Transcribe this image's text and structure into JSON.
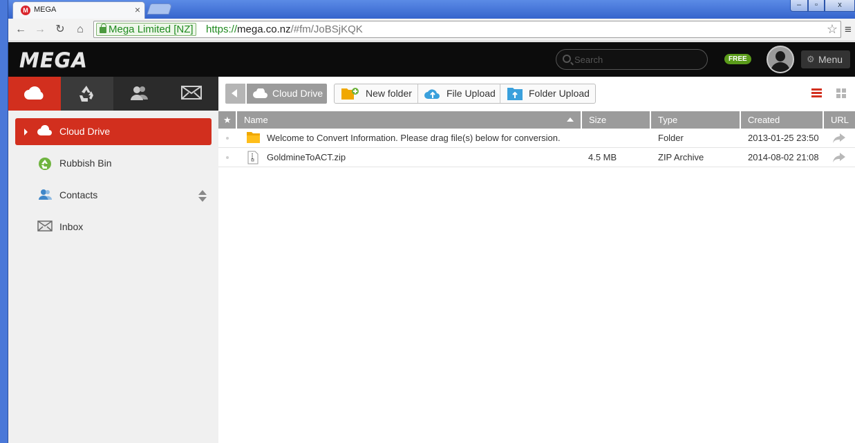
{
  "browser": {
    "tab_title": "MEGA",
    "tab_close": "×",
    "window_min": "–",
    "window_max": "▫",
    "window_close": "x",
    "nav_back": "←",
    "nav_forward": "→",
    "nav_reload": "↻",
    "nav_home": "⌂",
    "ev_cert": "Mega Limited [NZ]",
    "url_scheme": "https://",
    "url_host": "mega.co.nz",
    "url_path": "/#fm/JoBSjKQK",
    "star": "☆",
    "menu": "≡"
  },
  "header": {
    "logo": "MEGA",
    "search_placeholder": "Search",
    "badge": "FREE",
    "menu_label": "Menu",
    "gear": "⚙"
  },
  "sidebar": {
    "items": [
      {
        "label": "Cloud Drive"
      },
      {
        "label": "Rubbish Bin"
      },
      {
        "label": "Contacts"
      },
      {
        "label": "Inbox"
      }
    ]
  },
  "toolbar": {
    "breadcrumb": "Cloud Drive",
    "new_folder": "New folder",
    "file_upload": "File Upload",
    "folder_upload": "Folder Upload"
  },
  "table": {
    "star_header": "★",
    "columns": {
      "name": "Name",
      "size": "Size",
      "type": "Type",
      "created": "Created",
      "url": "URL"
    },
    "rows": [
      {
        "name": "Welcome to Convert Information.  Please drag file(s) below for conversion.",
        "size": "",
        "type": "Folder",
        "created": "2013-01-25 23:50",
        "icon": "folder-icon"
      },
      {
        "name": "GoldmineToACT.zip",
        "size": "4.5 MB",
        "type": "ZIP Archive",
        "created": "2014-08-02 21:08",
        "icon": "zip-file-icon"
      }
    ]
  },
  "colors": {
    "accent": "#d22f1e",
    "header_bg": "#0c0c0c",
    "free_badge": "#5a9b1a",
    "table_header": "#9b9b9b"
  }
}
